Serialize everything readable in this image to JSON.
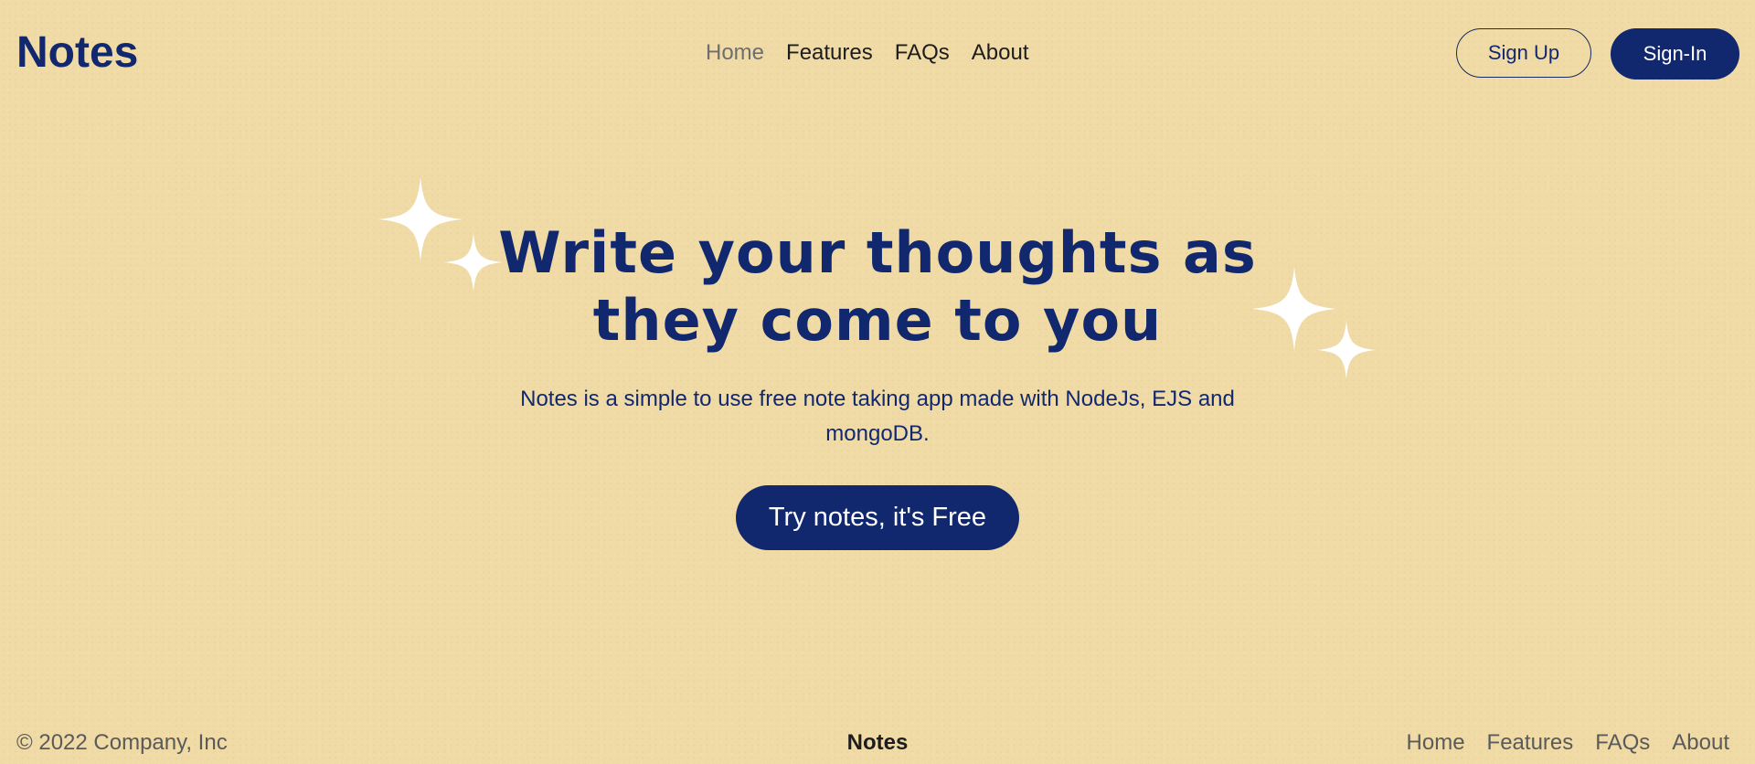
{
  "header": {
    "logo": "Notes",
    "nav": [
      {
        "label": "Home",
        "active": true
      },
      {
        "label": "Features",
        "active": false
      },
      {
        "label": "FAQs",
        "active": false
      },
      {
        "label": "About",
        "active": false
      }
    ],
    "signup_label": "Sign Up",
    "signin_label": "Sign-In"
  },
  "hero": {
    "title": "Write your thoughts as they come to you",
    "subtitle": "Notes is a simple to use free note taking app made with NodeJs, EJS and mongoDB.",
    "cta_label": "Try notes, it's Free"
  },
  "footer": {
    "copyright": "© 2022 Company, Inc",
    "brand": "Notes",
    "links": [
      "Home",
      "Features",
      "FAQs",
      "About"
    ]
  },
  "colors": {
    "background": "#f0dba6",
    "primary": "#12286e",
    "sparkle": "#ffffff"
  },
  "icons": [
    "sparkle-icon"
  ]
}
